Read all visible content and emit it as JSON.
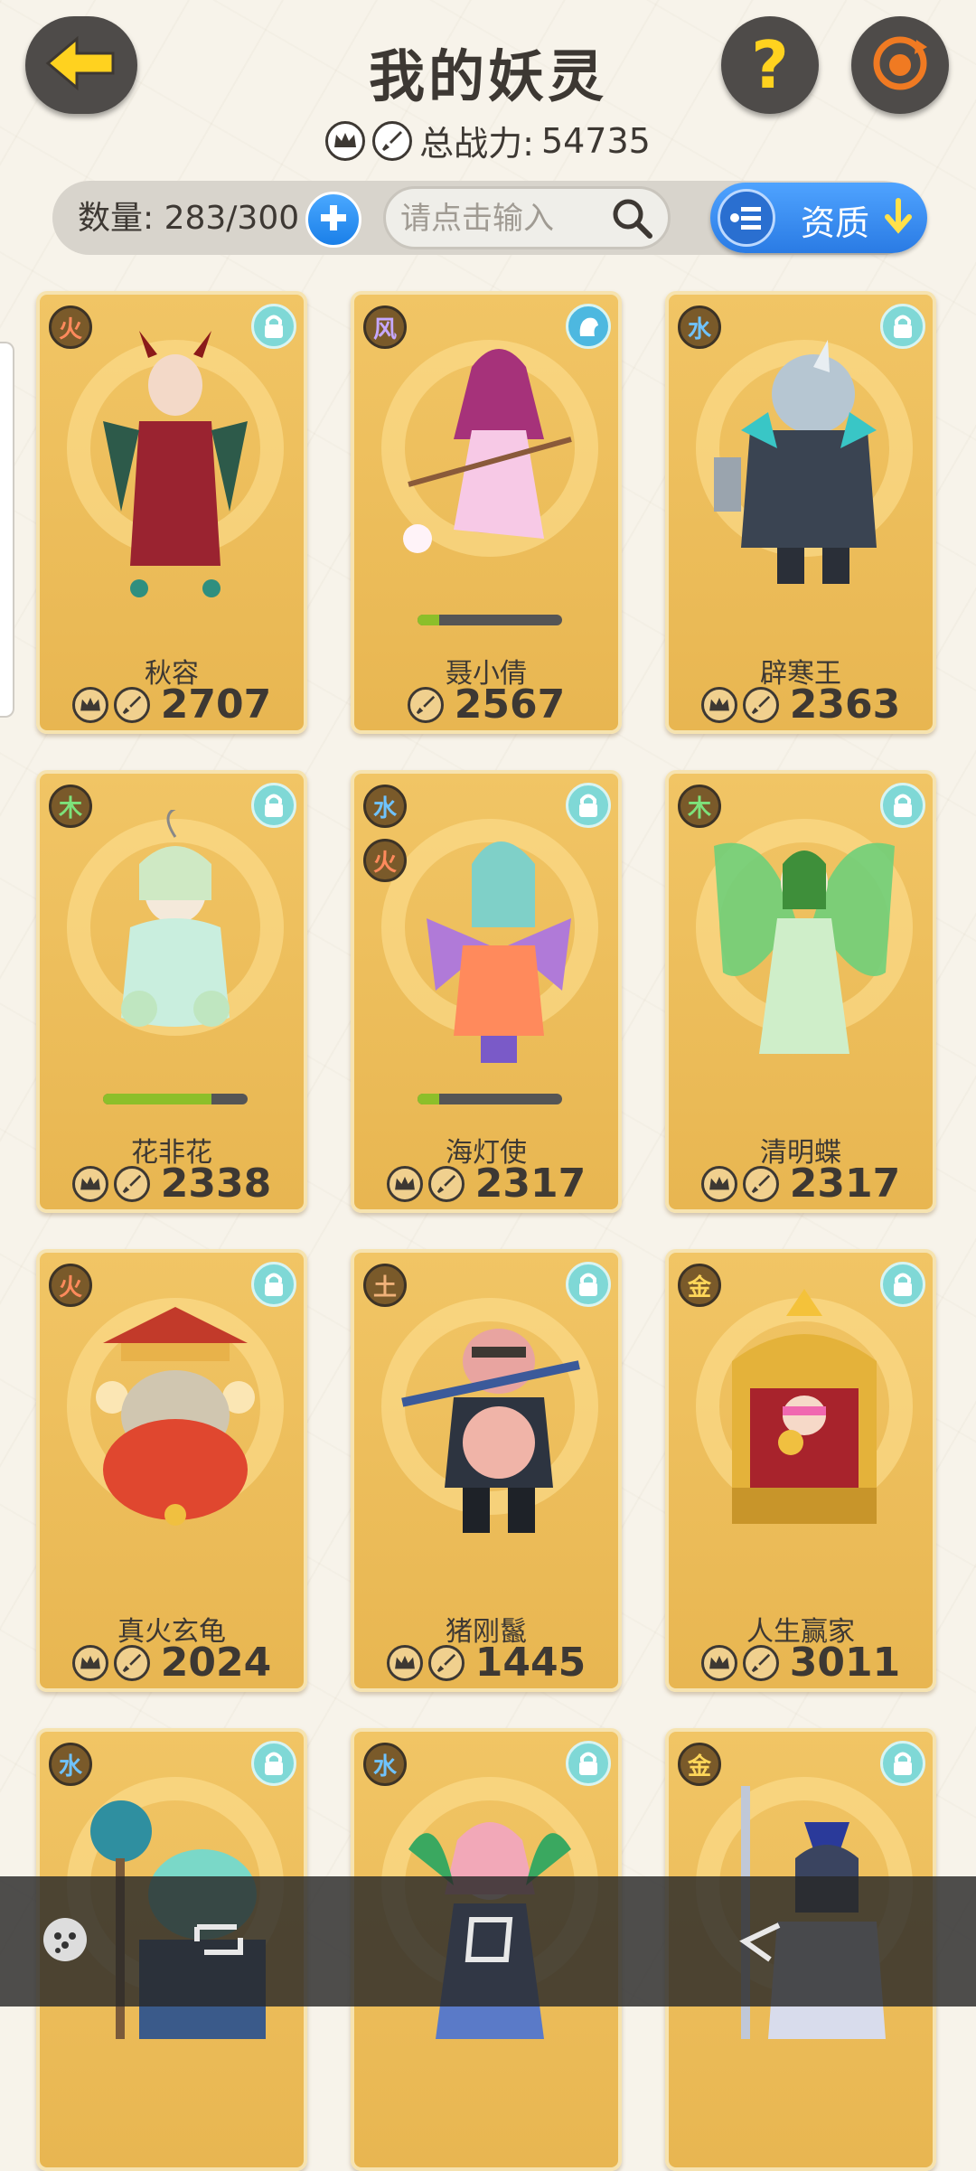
{
  "header": {
    "title": "我的妖灵",
    "total_power_label": "总战力:",
    "total_power_value": "54735"
  },
  "toolbar": {
    "count_label": "数量:",
    "count_value": "283/300",
    "search_placeholder": "请点击输入",
    "quality_label": "资质"
  },
  "cards": [
    {
      "name": "秋容",
      "elements": [
        "火"
      ],
      "power": "2707",
      "icons": [
        "crown-icon",
        "sword-icon"
      ],
      "lock": "lock-icon",
      "progress": null
    },
    {
      "name": "聂小倩",
      "elements": [
        "风"
      ],
      "power": "2567",
      "icons": [
        "sword-icon"
      ],
      "lock": "spirit-icon",
      "progress": 0.15
    },
    {
      "name": "辟寒王",
      "elements": [
        "水"
      ],
      "power": "2363",
      "icons": [
        "crown-icon",
        "sword-icon"
      ],
      "lock": "lock-icon",
      "progress": null
    },
    {
      "name": "花非花",
      "elements": [
        "木"
      ],
      "power": "2338",
      "icons": [
        "crown-icon",
        "sword-icon"
      ],
      "lock": "lock-icon",
      "progress": 0.75
    },
    {
      "name": "海灯使",
      "elements": [
        "水",
        "火"
      ],
      "power": "2317",
      "icons": [
        "crown-icon",
        "sword-icon"
      ],
      "lock": "lock-icon",
      "progress": 0.15
    },
    {
      "name": "清明蝶",
      "elements": [
        "木"
      ],
      "power": "2317",
      "icons": [
        "crown-icon",
        "sword-icon"
      ],
      "lock": "lock-icon",
      "progress": null
    },
    {
      "name": "真火玄龟",
      "elements": [
        "火"
      ],
      "power": "2024",
      "icons": [
        "crown-icon",
        "sword-icon"
      ],
      "lock": "lock-icon",
      "progress": null
    },
    {
      "name": "猪刚鬣",
      "elements": [
        "土"
      ],
      "power": "1445",
      "icons": [
        "crown-icon",
        "sword-icon"
      ],
      "lock": "lock-icon",
      "progress": null
    },
    {
      "name": "人生赢家",
      "elements": [
        "金"
      ],
      "power": "3011",
      "icons": [
        "crown-icon",
        "sword-icon"
      ],
      "lock": "lock-icon",
      "progress": null
    },
    {
      "name": "",
      "elements": [
        "水"
      ],
      "power": "",
      "icons": [],
      "lock": "lock-icon",
      "progress": null
    },
    {
      "name": "",
      "elements": [
        "水"
      ],
      "power": "",
      "icons": [],
      "lock": "lock-icon",
      "progress": null
    },
    {
      "name": "",
      "elements": [
        "金"
      ],
      "power": "",
      "icons": [],
      "lock": "lock-icon",
      "progress": null
    }
  ],
  "colors": {
    "card_gold": "#f1c565",
    "accent_blue": "#2a7be4",
    "header_button": "#4e4b49",
    "help_yellow": "#ffd21f",
    "refresh_orange": "#f07a22"
  }
}
